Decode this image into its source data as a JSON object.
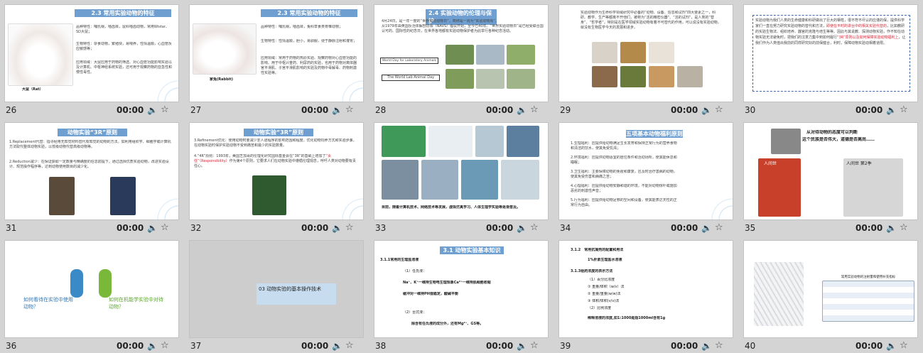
{
  "slides": [
    {
      "num": "26",
      "time": "00:00",
      "title": "2.3 常用实验动物的特征",
      "caption": "大鼠（Rat）",
      "lines": [
        "品种特性：哺乳纲，啮齿目，鼠科啮齿动物，常用Wistar、SD大鼠；",
        "生物特性：杂食动物，繁殖快，易喂养，性情温顺，心血管反应敏感等；",
        "应用领域：大鼠应用于药物的筛选、对心血管功能影响实验以及计算机、中枢神经系统实验，还可用于观察药物的亚急性和慢性毒性。"
      ]
    },
    {
      "num": "27",
      "time": "00:00",
      "title": "2.3 常用实验动物的特征",
      "caption": "家兔(Rabbit)",
      "lines": [
        "品种特性：哺乳纲，啮齿目，兔科草食类脊椎动物；",
        "生物特性：性情温顺，胆小，易驯服，便于静脉注射和灌胃；",
        "应用领域：常用于药物的热原实验、观察药物对心血管功能的影响、用于中枢兴奋药、利尿药的实验，也用于药物对离体器官平滑肌、子宫平滑肌影响的实验及药物中毒解毒、药物刺激性实验等。"
      ]
    },
    {
      "num": "28",
      "time": "00:00",
      "title": "2.4 实验动物的伦理与保护",
      "lines": [
        "4月24日，是一年一度的“世界实验动物日”，简称是一周为“实验动物周”。",
        "从1979年由英国反活体解剖协会（NAVS）倡议开始，至今已40年。“世界实验动物日”是已经受联合国认可的、国际性的纪念日，在世界各地都有实验动物保护者为此举行各种纪念活动。"
      ],
      "logo1": "World Day for Laboratory Animals",
      "logo2": "The World Lab Animal Day"
    },
    {
      "num": "29",
      "time": "00:00",
      "lines": [
        "实验动物作为生命科学领域研究中必备的“动物、设备、信息和试剂”四大要素之一，科研、教学、生产等都离不开他们，被称为“活的精密仪器”、“活的试剂”，是人类的“替身”、“哲学者”，特别是在医学领域实验动物有着不可替代的作用，可以说没有实验动物，就没有生物医学今天的发展和进步。"
      ]
    },
    {
      "num": "30",
      "time": "00:00",
      "lines": [
        "实验动物为我们人类的生命健康和科研做出了巨大的牺牲，很不符不尽认的应谨的保，提供科学家们一直在努力研究实验动物的替代和方法，",
        "即使在平时的讲台中的相关实验代替的",
        "，比如教研的实验生物法、组织培养、器官的克隆与培生等等。",
        "因此与其说教、探测动物实验，作不知在动物实验无法避免时，把我们的注意力集中到如何履行",
        "“3R”原则以及如何保障实验动物福利上",
        "，让我们作为人类值出我前的同样研究好的前保健合，利时，保障动物实验动相着道限。"
      ]
    },
    {
      "num": "31",
      "time": "00:00",
      "title": "动物实验“3R”原则",
      "lines": [
        "1.Replacement代替：指寻经用无知觉材料替代有知觉的动物的方法。如利用组织学、细胞学或计算机方法取代整体动物实验，以低级动物代替高级动物等。",
        "2.Reduction减少：在保证获取一定数量与精确度的信息前提下，通过选择优质实验动物，改进实验设计、规范操作程序等，达到动物使用数目的减少化。"
      ]
    },
    {
      "num": "32",
      "time": "00:00",
      "title": "动物实验“3R”原则",
      "lines": [
        "3.Refinement优化：使用动物时要减少非人道程序的影响范围和程度。优化动物饲养方式和实验步骤，在动物实验时保护实验动物不受到痛苦和最少的实验数量。",
        "4.“4R”原则：1993年，美国芝加哥的伦理化研究国际基金会在“3R”的基础上增加了",
        "“责任”（Responsibility）",
        "作为第4个原则，它要求人们在动物实验中遵循伦理观念，呼吁人类对动物要有责任心。"
      ]
    },
    {
      "num": "33",
      "time": "00:00",
      "lines": [
        "目前，随着计算机技术、网络技术等发展，虚拟仿真学习、人体生理学实验等逐渐普及。"
      ]
    },
    {
      "num": "34",
      "time": "00:00",
      "title": "五项基本动物福利原则",
      "lines": [
        "1.生理福利：应提供给动物满足生长发育和保持正常行为的营养食物和清洁的饮水，使其免受饥渴；",
        "2.环境福利：应提供动物适宜的居住条件和活动场所，使其能休息和睡眠；",
        "3.卫生福利：主要保障动物的免疫和康复，应及时治疗患病的动物，使其免受伤害和病痛之苦；",
        "4.心理福利：应提供给动物安静和谐的环境，不能对动物惊吓或施加恶劣的刺激性声音；",
        "5.行为福利：应提供给动物足够的空间和设备，使其能表达天性的正常行为自由。"
      ]
    },
    {
      "num": "35",
      "time": "00:00",
      "lines": [
        "从对待动物的态度可以判断",
        "这个民族是否伟大，道德是否高尚……"
      ],
      "book1": "人间世",
      "book2": "人间世 第2季"
    },
    {
      "num": "36",
      "time": "00:00",
      "lines": [
        "如何看待在实验中使用动物？",
        "如何在机能学实验中对待动物？"
      ]
    },
    {
      "num": "37",
      "time": "00:00",
      "lines": [
        "03 动物实验的基本操作技术"
      ]
    },
    {
      "num": "38",
      "time": "00:00",
      "title": "3.1 动物实验基本知识",
      "lines": [
        "3.1.1常用的生理盐溶液",
        "（1）任氏液：",
        "Na⁺、K⁺一维持生物电生理现象Ca²⁺一维持肌细胞收缩",
        "缓冲对一维持PH值稳定，酸碱平衡",
        "（2）台式液：",
        "除含有任氏液的成分外，还有Mg²⁺、GS等。"
      ]
    },
    {
      "num": "39",
      "time": "00:00",
      "lines": [
        "3.1.2　常用抗凝剂的配置和用法",
        "1%肝素生理盐水溶液",
        "3.1.3给药浓度的表示方法",
        "（1）百分比浓度",
        "① 重量/体积（w/v）法",
        "② 重量/重量(w/w)法",
        "③ 体积/体积(v/v)法",
        "（2）比例浓度",
        "稀释溶液的浓度,如1:1000是指1000ml含有1g"
      ]
    },
    {
      "num": "40",
      "time": "00:00",
      "lines": [
        "常用实验动物的注射量和使用补充指标"
      ],
      "table_header": [
        "",
        "",
        "小鼠",
        "大鼠",
        "豚鼠",
        "兔",
        "狗"
      ]
    }
  ],
  "colors": {
    "accent_bar": "#6f9fd0",
    "selected_border": "#f0a030",
    "red_text": "#dd2233"
  },
  "icons": {
    "audio": "speaker-icon",
    "favorite": "star-icon"
  }
}
